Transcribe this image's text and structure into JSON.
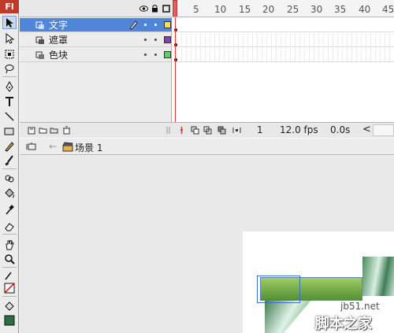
{
  "app": {
    "logo": "Fl"
  },
  "timeline": {
    "ruler": [
      "5",
      "10",
      "15",
      "20",
      "25",
      "30",
      "35",
      "40",
      "45"
    ],
    "layers": [
      {
        "name": "文字",
        "color": "#f0e060",
        "selected": true
      },
      {
        "name": "遮罩",
        "color": "#8040c0",
        "selected": false
      },
      {
        "name": "色块",
        "color": "#60d060",
        "selected": false
      }
    ],
    "status": {
      "frame": "1",
      "fps": "12.0 fps",
      "time": "0.0s",
      "scroll_left": "<"
    }
  },
  "editbar": {
    "back_arrow": "←",
    "scene": "场景 1"
  },
  "watermark": {
    "url": "jb51.net",
    "name": "脚本之家"
  },
  "colors": {
    "selection": "#4f86d9",
    "playhead": "#d43a3a",
    "logo_bg": "#c0392b"
  }
}
